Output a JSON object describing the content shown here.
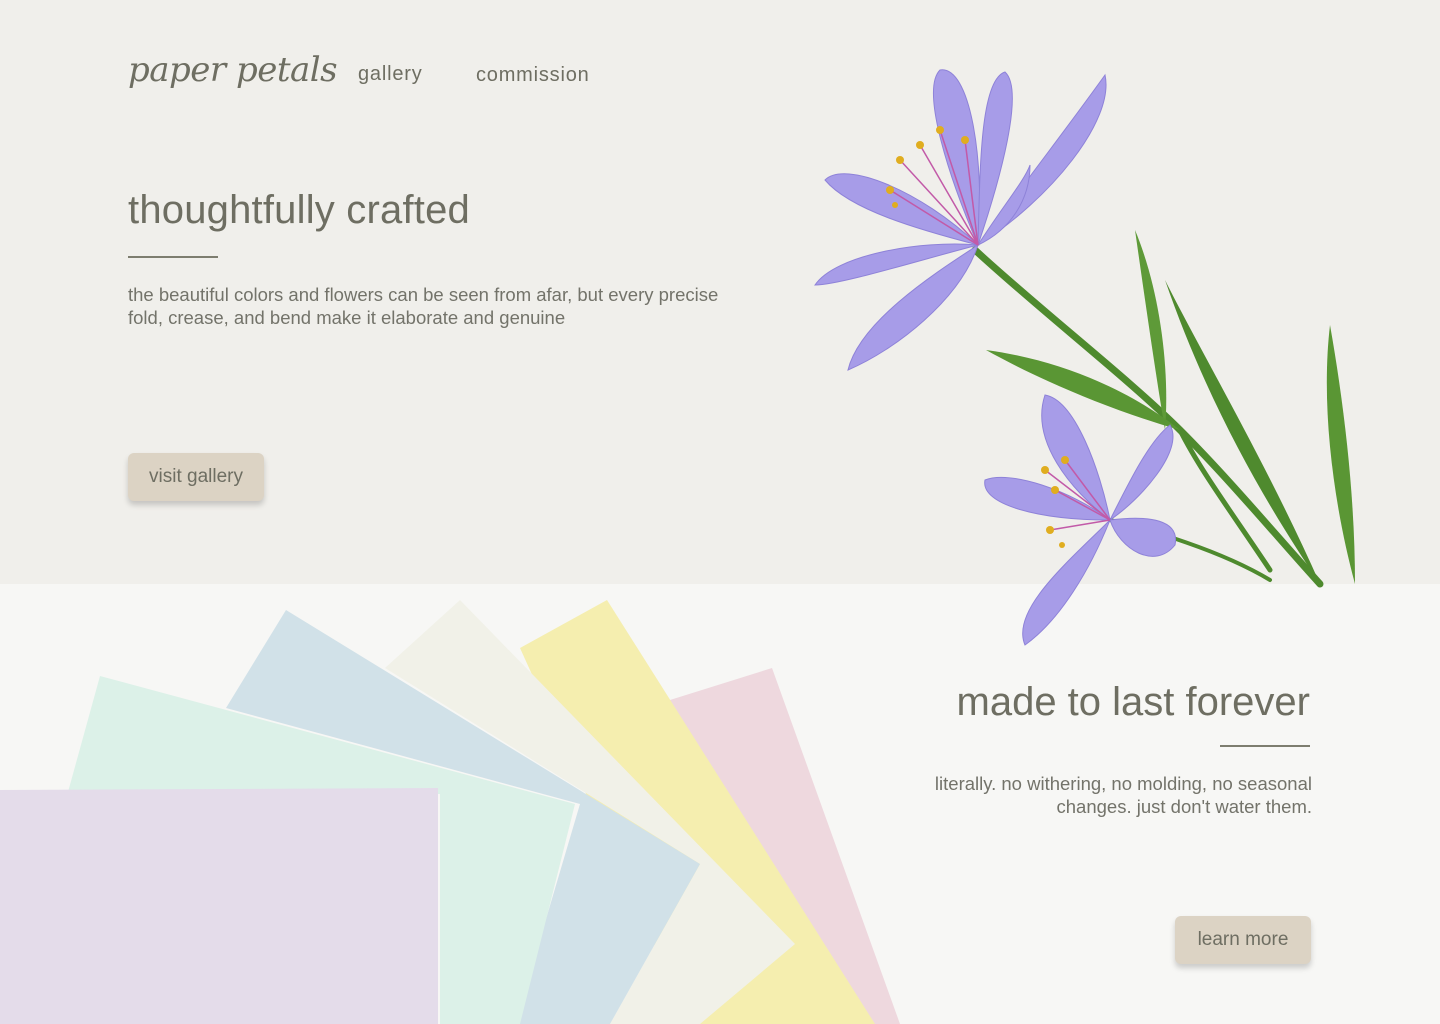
{
  "brand": {
    "name": "paper petals"
  },
  "nav": {
    "items": [
      {
        "label": "gallery"
      },
      {
        "label": "commission"
      }
    ]
  },
  "hero": {
    "title": "thoughtfully crafted",
    "body": "the beautiful colors and flowers can be seen from afar, but every precise fold, crease, and bend make it elaborate and genuine",
    "button_label": "visit gallery",
    "image": "purple-lily-flower-illustration"
  },
  "feature": {
    "title": "made to last forever",
    "body": "literally. no withering, no molding, no seasonal changes. just don't water them.",
    "button_label": "learn more",
    "image": "fanned-pastel-paper-sheets"
  },
  "colors": {
    "hero_bg": "#f0efeb",
    "lower_bg": "#f7f7f5",
    "text": "#6e6e62",
    "button": "#dcd3c4",
    "petal": "#a79ce8",
    "stem": "#4e8a2e",
    "paper_lavender": "#e4dcea",
    "paper_mint": "#dcf1e8",
    "paper_blue": "#d1e1e8",
    "paper_cream": "#f1f1e8",
    "paper_yellow": "#f5eeaf",
    "paper_pink": "#eed8de"
  }
}
